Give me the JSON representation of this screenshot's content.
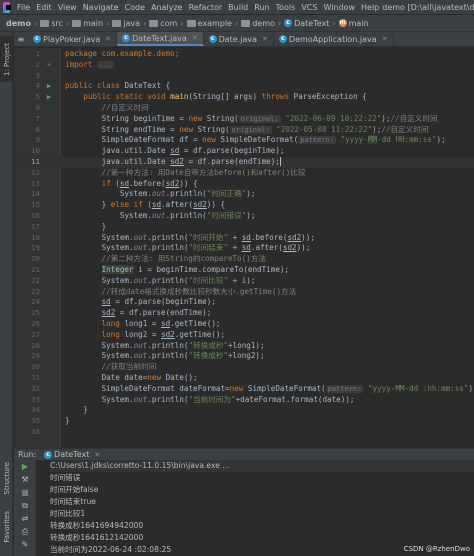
{
  "menubar": {
    "items": [
      "File",
      "Edit",
      "View",
      "Navigate",
      "Code",
      "Analyze",
      "Refactor",
      "Build",
      "Run",
      "Tools",
      "VCS",
      "Window",
      "Help"
    ],
    "window_title": "demo [D:\\all\\javatext\\demo] - DateT"
  },
  "breadcrumb": [
    "demo",
    "src",
    "main",
    "java",
    "com",
    "example",
    "demo",
    "DateText",
    "main"
  ],
  "left_tabs": [
    "1: Project",
    "Structure",
    "Favorites"
  ],
  "tabs": [
    {
      "label": "PlayPoker.java"
    },
    {
      "label": "DateText.java"
    },
    {
      "label": "Date.java"
    },
    {
      "label": "DemoApplication.java"
    }
  ],
  "code": {
    "line_numbers": [
      "1",
      "2",
      "3",
      "4",
      "5",
      "6",
      "7",
      "8",
      "9",
      "10",
      "11",
      "12",
      "13",
      "14",
      "15",
      "16",
      "17",
      "18",
      "19",
      "20",
      "21",
      "22",
      "23",
      "24",
      "25",
      "26",
      "27",
      "28",
      "29",
      "30",
      "31",
      "32",
      "33",
      "34",
      "35",
      "36"
    ],
    "l1_pkg": "package com.example.demo;",
    "l2_import": "import",
    "l2_fold": "...",
    "l4_a": "public class ",
    "l4_b": "DateText {",
    "l5_a": "public static void ",
    "l5_b": "main",
    "l5_c": "(String[] args) ",
    "l5_d": "throws ",
    "l5_e": "ParseException {",
    "l6": "//自定义时间",
    "l7_a": "String beginTime = ",
    "l7_b": "new ",
    "l7_c": "String(",
    "l7_hint": "original:",
    "l7_s": "\"2022-06-09 10:22:22\"",
    "l7_d": ");",
    "l7_cm": "//自定义时间",
    "l8_a": "String endTime = ",
    "l8_s": "\"2022-05-08 11:22:22\"",
    "l9_a": "SimpleDateFormat df = ",
    "l9_b": "SimpleDateFormat(",
    "l9_hint": "pattern:",
    "l9_s1": "\"yyyy-",
    "l9_s2": "MM",
    "l9_s3": "-dd HH:mm:ss\"",
    "l10_a": "java.util.Date ",
    "l10_b": "sd",
    "l10_c": " = df.parse(beginTime);",
    "l11_b": "sd2",
    "l11_c": " = df.parse(endTime);",
    "l12": "//第一种方法: 用Date自带方法before()和after()比较",
    "l13_a": "if ",
    "l13_b": "(",
    "l13_c": ".before(",
    "l13_d": ")) {",
    "l14_a": "System.",
    "l14_out": "out",
    "l14_b": ".println(",
    "l14_s": "\"时间正确\"",
    "l14_c": ");",
    "l15_a": "} ",
    "l15_b": "else if ",
    "l15_c": ".after(",
    "l16_s": "\"时间错误\"",
    "l17": "}",
    "l18_s": "\"时间开始\"",
    "l18_b": " + ",
    "l18_c": ".before(",
    "l18_d": "));",
    "l19_s": "\"时间结束\"",
    "l19_c": ".after(",
    "l20": "//第二种方法: 用String的compareTo()方法",
    "l21_a": "Integer",
    "l21_b": " i = beginTime.compareTo(endTime);",
    "l22_s": "\"时间比较\"",
    "l22_b": " + i);",
    "l23": "//转成date格式换成秒数比较秒数大小.getTime()方法",
    "l24_c": " = df.parse(beginTime);",
    "l25_c": " = df.parse(endTime);",
    "l26_a": "long ",
    "l26_b": "long1 = ",
    "l26_c": ".getTime();",
    "l27_b": "long2 = ",
    "l28_s": "\"转换成秒\"",
    "l28_b": "+long1);",
    "l29_b": "+long2);",
    "l30": "//获取当前时间",
    "l31_a": "Date date=",
    "l31_b": "Date();",
    "l32_a": "SimpleDateFormat dateFormat=",
    "l32_s": "\"yyyy-MM-dd :hh:mm:ss\"",
    "l32_b": ");",
    "l33_s": "\"当前时间为\"",
    "l33_b": "+dateFormat.format(date));",
    "l34": "}",
    "l35": "}"
  },
  "run_panel": {
    "label": "Run:",
    "tab": "DateText",
    "console": [
      "C:\\Users\\1.jdks\\corretto-11.0.15\\bin\\java.exe ...",
      "时间错误",
      "时间开始false",
      "时间结束true",
      "时间比较1",
      "转换成秒1641694942000",
      "转换成秒1641612142000",
      "当前时间为2022-06-24 :02:08:25"
    ]
  },
  "watermark": "CSDN @RzhenDwo",
  "colors": {
    "keyword": "#cc7832",
    "string": "#6a8759",
    "comment": "#808080",
    "method": "#ffc66d",
    "static": "#9876aa"
  }
}
